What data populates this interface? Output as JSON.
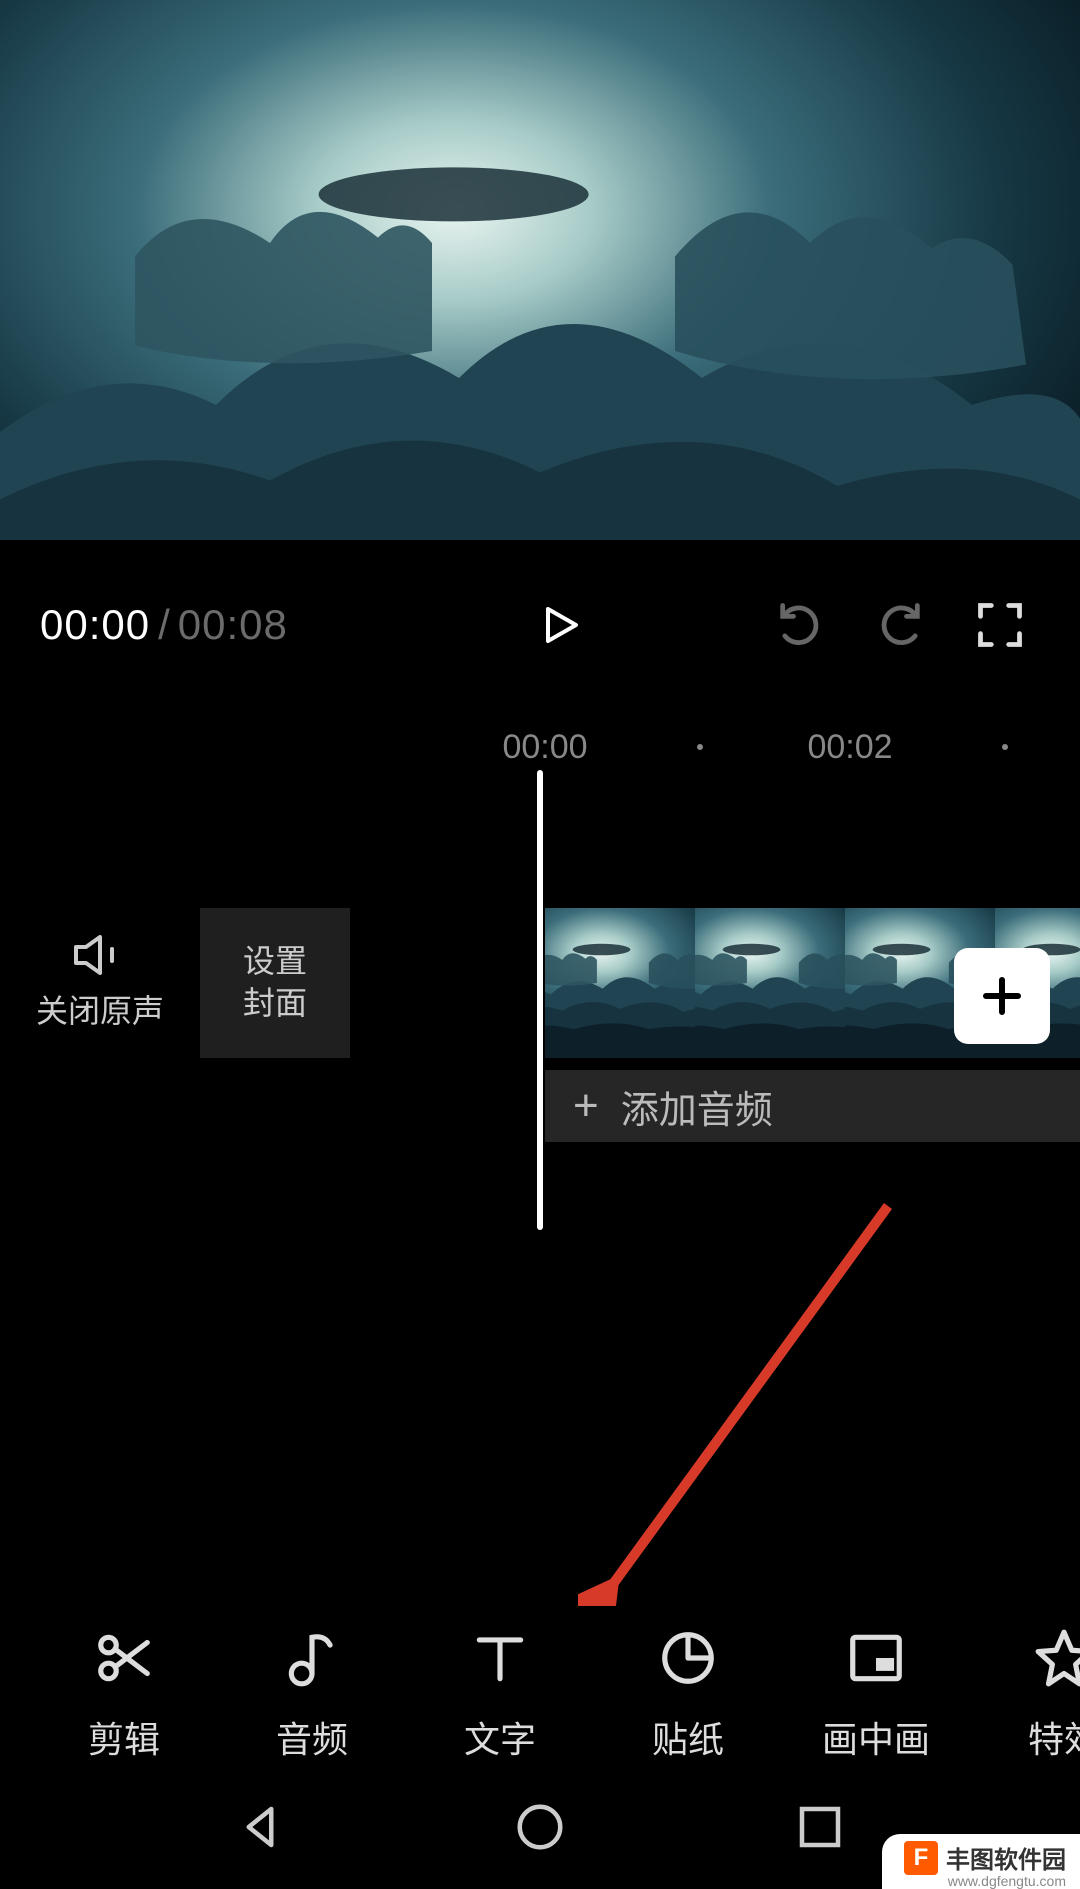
{
  "playback": {
    "current": "00:00",
    "separator": "/",
    "total": "00:08"
  },
  "ruler": {
    "marks": [
      "00:00",
      "00:02"
    ]
  },
  "timeline": {
    "mute_label": "关闭原声",
    "cover_label": "设置\n封面",
    "add_audio_label": "添加音频"
  },
  "tools": [
    {
      "id": "cut",
      "label": "剪辑"
    },
    {
      "id": "audio",
      "label": "音频"
    },
    {
      "id": "text",
      "label": "文字"
    },
    {
      "id": "sticker",
      "label": "贴纸"
    },
    {
      "id": "pip",
      "label": "画中画"
    },
    {
      "id": "fx",
      "label": "特效"
    }
  ],
  "watermark": {
    "brand": "丰图软件园",
    "url": "www.dgfengtu.com",
    "logo_char": "F"
  }
}
